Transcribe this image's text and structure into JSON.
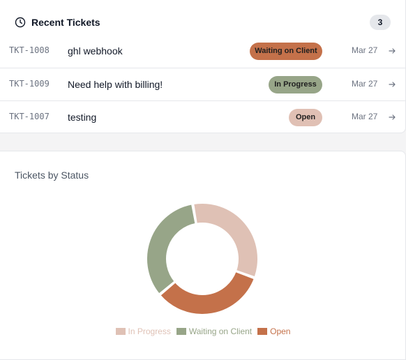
{
  "recent_tickets": {
    "title": "Recent Tickets",
    "count": "3",
    "icon": "clock-icon",
    "rows": [
      {
        "id": "TKT-1008",
        "subject": "ghl webhook",
        "status": "Waiting on Client",
        "date": "Mar 27"
      },
      {
        "id": "TKT-1009",
        "subject": "Need help with billing!",
        "status": "In Progress",
        "date": "Mar 27"
      },
      {
        "id": "TKT-1007",
        "subject": "testing",
        "status": "Open",
        "date": "Mar 27"
      }
    ]
  },
  "status_colors": {
    "Waiting on Client": {
      "bg": "#c4714a",
      "fg": "#1f1f1f"
    },
    "In Progress": {
      "bg": "#97a588",
      "fg": "#1f1f1f"
    },
    "Open": {
      "bg": "#e0c0b4",
      "fg": "#1f1f1f"
    }
  },
  "chart_data": {
    "type": "pie",
    "title": "Tickets by Status",
    "donut": true,
    "categories": [
      "In Progress",
      "Waiting on Client",
      "Open"
    ],
    "values": [
      1,
      1,
      1
    ],
    "colors": [
      "#dfc1b5",
      "#97a588",
      "#c4714a"
    ],
    "legend_position": "bottom"
  }
}
